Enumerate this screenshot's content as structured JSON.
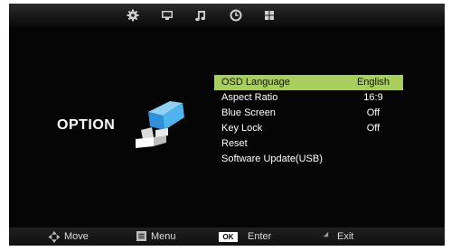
{
  "tabs": [
    {
      "icon": "gear-icon"
    },
    {
      "icon": "monitor-icon"
    },
    {
      "icon": "music-note-icon"
    },
    {
      "icon": "clock-icon"
    },
    {
      "icon": "grid-icon"
    }
  ],
  "page": {
    "title": "OPTION"
  },
  "menu": {
    "items": [
      {
        "label": "OSD Language",
        "value": "English",
        "selected": true
      },
      {
        "label": "Aspect Ratio",
        "value": "16:9"
      },
      {
        "label": "Blue Screen",
        "value": "Off"
      },
      {
        "label": "Key Lock",
        "value": "Off"
      },
      {
        "label": "Reset",
        "value": ""
      },
      {
        "label": "Software Update(USB)",
        "value": ""
      }
    ]
  },
  "footer": {
    "move_label": "Move",
    "menu_label": "Menu",
    "ok_key": "OK",
    "enter_label": "Enter",
    "exit_label": "Exit"
  },
  "colors": {
    "selected_row": "#a8cf5b",
    "background": "#050505",
    "accent_blue": "#3aa8e8"
  }
}
